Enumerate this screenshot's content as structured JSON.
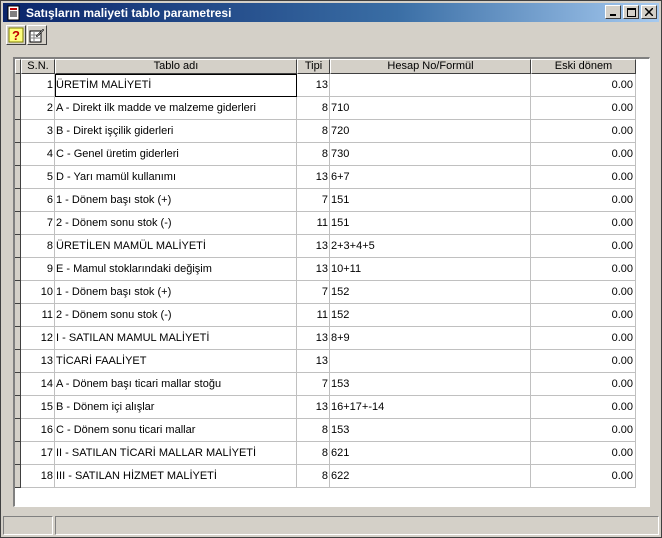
{
  "window": {
    "title": "Satışların maliyeti tablo parametresi"
  },
  "toolbar": {
    "help_icon": "question-mark-icon",
    "settings_icon": "pencil-grid-icon"
  },
  "table": {
    "columns": [
      "S.N.",
      "Tablo adı",
      "Tipi",
      "Hesap No/Formül",
      "Eski dönem"
    ],
    "rows": [
      {
        "sn": "1",
        "ad": "ÜRETİM MALİYETİ",
        "tip": "13",
        "hesap": "",
        "eski": "0.00"
      },
      {
        "sn": "2",
        "ad": "A - Direkt ilk madde ve malzeme giderleri",
        "tip": "8",
        "hesap": "710",
        "eski": "0.00"
      },
      {
        "sn": "3",
        "ad": "B - Direkt işçilik giderleri",
        "tip": "8",
        "hesap": "720",
        "eski": "0.00"
      },
      {
        "sn": "4",
        "ad": "C - Genel üretim giderleri",
        "tip": "8",
        "hesap": "730",
        "eski": "0.00"
      },
      {
        "sn": "5",
        "ad": "D - Yarı mamül kullanımı",
        "tip": "13",
        "hesap": "6+7",
        "eski": "0.00"
      },
      {
        "sn": "6",
        "ad": "1 - Dönem başı stok (+)",
        "tip": "7",
        "hesap": "151",
        "eski": "0.00"
      },
      {
        "sn": "7",
        "ad": "2 - Dönem sonu stok (-)",
        "tip": "11",
        "hesap": "151",
        "eski": "0.00"
      },
      {
        "sn": "8",
        "ad": "ÜRETİLEN MAMÜL MALİYETİ",
        "tip": "13",
        "hesap": "2+3+4+5",
        "eski": "0.00"
      },
      {
        "sn": "9",
        "ad": "E - Mamul stoklarındaki değişim",
        "tip": "13",
        "hesap": "10+11",
        "eski": "0.00"
      },
      {
        "sn": "10",
        "ad": "1 - Dönem başı stok (+)",
        "tip": "7",
        "hesap": "152",
        "eski": "0.00"
      },
      {
        "sn": "11",
        "ad": "2 - Dönem sonu stok (-)",
        "tip": "11",
        "hesap": "152",
        "eski": "0.00"
      },
      {
        "sn": "12",
        "ad": "I - SATILAN MAMUL MALİYETİ",
        "tip": "13",
        "hesap": "8+9",
        "eski": "0.00"
      },
      {
        "sn": "13",
        "ad": "TİCARİ FAALİYET",
        "tip": "13",
        "hesap": "",
        "eski": "0.00"
      },
      {
        "sn": "14",
        "ad": "A - Dönem başı ticari mallar stoğu",
        "tip": "7",
        "hesap": "153",
        "eski": "0.00"
      },
      {
        "sn": "15",
        "ad": "B - Dönem içi alışlar",
        "tip": "13",
        "hesap": "16+17+-14",
        "eski": "0.00"
      },
      {
        "sn": "16",
        "ad": "C - Dönem sonu ticari mallar",
        "tip": "8",
        "hesap": "153",
        "eski": "0.00"
      },
      {
        "sn": "17",
        "ad": "II - SATILAN TİCARİ MALLAR MALİYETİ",
        "tip": "8",
        "hesap": "621",
        "eski": "0.00"
      },
      {
        "sn": "18",
        "ad": "III - SATILAN HİZMET MALİYETİ",
        "tip": "8",
        "hesap": "622",
        "eski": "0.00"
      }
    ]
  }
}
